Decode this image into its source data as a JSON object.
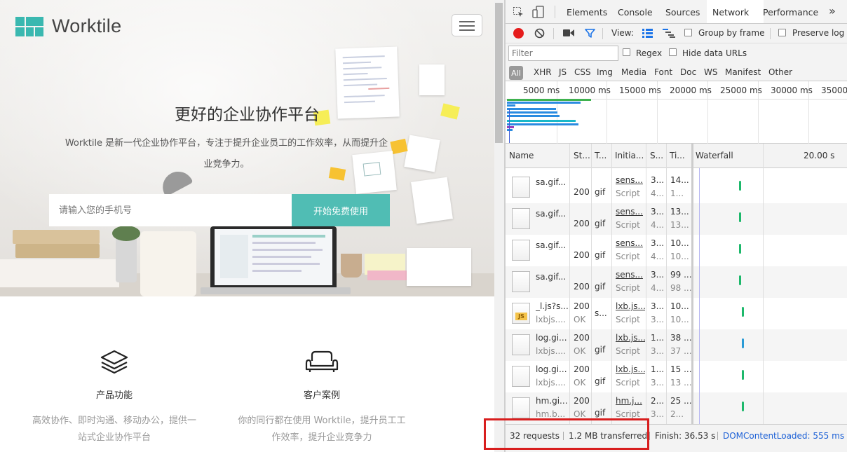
{
  "site": {
    "brand": "Worktile",
    "hero_title": "更好的企业协作平台",
    "hero_desc_line1": "Worktile 是新一代企业协作平台，专注于提升企业员工的工作效率，从而提升企",
    "hero_desc_line2": "业竞争力。",
    "phone_placeholder": "请输入您的手机号",
    "start_button": "开始免费使用",
    "features": [
      {
        "title": "产品功能",
        "desc_line1": "高效协作、即时沟通、移动办公，提供一",
        "desc_line2": "站式企业协作平台"
      },
      {
        "title": "客户案例",
        "desc_line1": "你的同行都在使用 Worktile，提升员工工",
        "desc_line2": "作效率，提升企业竞争力"
      }
    ]
  },
  "devtools": {
    "tabs": [
      "Elements",
      "Console",
      "Sources",
      "Network",
      "Performance"
    ],
    "active_tab": "Network",
    "more_tabs": "»",
    "view_label": "View:",
    "group_by_frame": "Group by frame",
    "preserve_log": "Preserve log",
    "filter_placeholder": "Filter",
    "regex": "Regex",
    "hide_data_urls": "Hide data URLs",
    "types": [
      "All",
      "XHR",
      "JS",
      "CSS",
      "Img",
      "Media",
      "Font",
      "Doc",
      "WS",
      "Manifest",
      "Other"
    ],
    "overview_ticks": [
      "5000 ms",
      "10000 ms",
      "15000 ms",
      "20000 ms",
      "25000 ms",
      "30000 ms",
      "35000"
    ],
    "columns": {
      "name": "Name",
      "status": "St...",
      "type": "T...",
      "initiator": "Initia...",
      "size": "S...",
      "time": "Ti...",
      "waterfall": "Waterfall",
      "waterfall_scale": "20.00 s"
    },
    "rows": [
      {
        "name": "sa.gif...",
        "name_sub": "",
        "status": "200",
        "status_sub": "",
        "type": "gif",
        "initiator": "sens...",
        "initiator_sub": "Script",
        "size": "3...",
        "size_sub": "4...",
        "time": "14...",
        "time_sub": "1...",
        "icon": "image-file-icon",
        "wf_color": "#1db86b"
      },
      {
        "name": "sa.gif...",
        "name_sub": "",
        "status": "200",
        "status_sub": "",
        "type": "gif",
        "initiator": "sens...",
        "initiator_sub": "Script",
        "size": "3...",
        "size_sub": "4...",
        "time": "13...",
        "time_sub": "13...",
        "icon": "image-file-icon",
        "wf_color": "#1db86b"
      },
      {
        "name": "sa.gif...",
        "name_sub": "",
        "status": "200",
        "status_sub": "",
        "type": "gif",
        "initiator": "sens...",
        "initiator_sub": "Script",
        "size": "3...",
        "size_sub": "4...",
        "time": "10...",
        "time_sub": "10...",
        "icon": "image-file-icon",
        "wf_color": "#1db86b"
      },
      {
        "name": "sa.gif...",
        "name_sub": "",
        "status": "200",
        "status_sub": "",
        "type": "gif",
        "initiator": "sens...",
        "initiator_sub": "Script",
        "size": "3...",
        "size_sub": "4...",
        "time": "99 ...",
        "time_sub": "98 ...",
        "icon": "image-file-icon",
        "wf_color": "#1db86b"
      },
      {
        "name": "_l.js?s...",
        "name_sub": "lxbjs....",
        "status": "200",
        "status_sub": "OK",
        "type": "s...",
        "initiator": "lxb.js...",
        "initiator_sub": "Script",
        "size": "3...",
        "size_sub": "3...",
        "time": "10...",
        "time_sub": "10...",
        "icon": "js-file-icon",
        "wf_color": "#1db86b"
      },
      {
        "name": "log.gi...",
        "name_sub": "lxbjs....",
        "status": "200",
        "status_sub": "OK",
        "type": "gif",
        "initiator": "lxb.js...",
        "initiator_sub": "Script",
        "size": "1...",
        "size_sub": "3...",
        "time": "38 ...",
        "time_sub": "37 ...",
        "icon": "image-file-icon",
        "wf_color": "#2a9bd6"
      },
      {
        "name": "log.gi...",
        "name_sub": "lxbjs....",
        "status": "200",
        "status_sub": "OK",
        "type": "gif",
        "initiator": "lxb.js...",
        "initiator_sub": "Script",
        "size": "1...",
        "size_sub": "3...",
        "time": "15 ...",
        "time_sub": "13 ...",
        "icon": "image-file-icon",
        "wf_color": "#1db86b"
      },
      {
        "name": "hm.gi...",
        "name_sub": "hm.b...",
        "status": "200",
        "status_sub": "OK",
        "type": "gif",
        "initiator": "hm.j...",
        "initiator_sub": "Script",
        "size": "2...",
        "size_sub": "3...",
        "time": "25 ...",
        "time_sub": "2...",
        "icon": "image-file-icon",
        "wf_color": "#1db86b"
      }
    ],
    "status_bar": {
      "requests": "32 requests",
      "transferred": "1.2 MB transferred",
      "finish": "Finish: 36.53 s",
      "dom_content_loaded": "DOMContentLoaded: 555 ms",
      "dcl_color": "#1a5fd6"
    }
  },
  "colors": {
    "brand_teal": "#50bdb4",
    "highlight_red": "#d81e1e"
  }
}
